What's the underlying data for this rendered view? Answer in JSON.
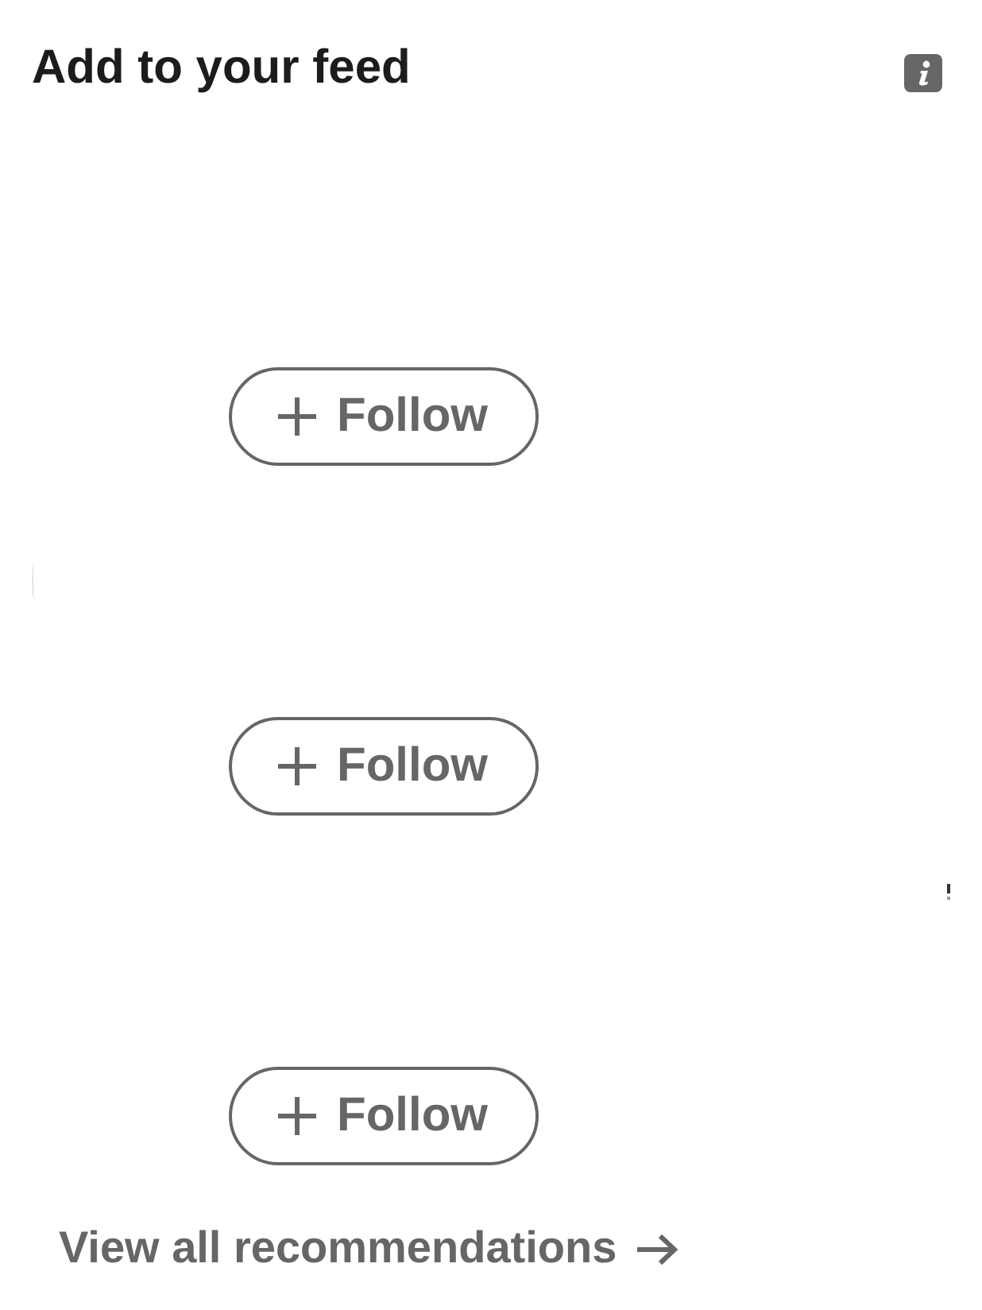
{
  "header": {
    "title": "Add to your feed"
  },
  "recommendations": [
    {
      "button": {
        "label": "Follow"
      }
    },
    {
      "button": {
        "label": "Follow"
      }
    },
    {
      "button": {
        "label": "Follow"
      }
    }
  ],
  "footer": {
    "link": "View all recommendations"
  }
}
